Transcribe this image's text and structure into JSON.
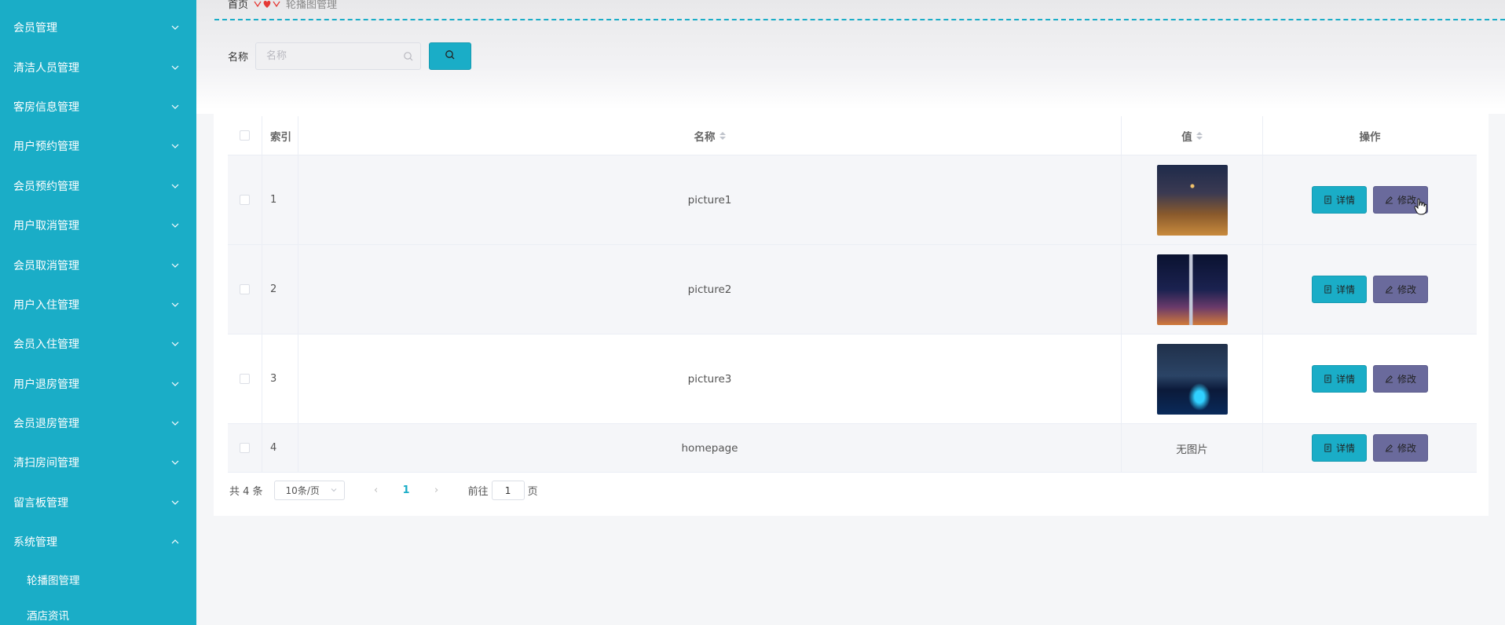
{
  "sidebar": {
    "items": [
      {
        "label": "会员管理"
      },
      {
        "label": "清洁人员管理"
      },
      {
        "label": "客房信息管理"
      },
      {
        "label": "用户预约管理"
      },
      {
        "label": "会员预约管理"
      },
      {
        "label": "用户取消管理"
      },
      {
        "label": "会员取消管理"
      },
      {
        "label": "用户入住管理"
      },
      {
        "label": "会员入住管理"
      },
      {
        "label": "用户退房管理"
      },
      {
        "label": "会员退房管理"
      },
      {
        "label": "清扫房间管理"
      },
      {
        "label": "留言板管理"
      },
      {
        "label": "系统管理",
        "expanded": true
      }
    ],
    "sub_items": [
      {
        "label": "轮播图管理"
      },
      {
        "label": "酒店资讯"
      }
    ],
    "bg_color": "#1aadc7"
  },
  "breadcrumb": {
    "home": "首页",
    "current": "轮播图管理"
  },
  "search": {
    "label": "名称",
    "placeholder": "名称",
    "value": ""
  },
  "table": {
    "headers": {
      "index": "索引",
      "name": "名称",
      "value": "值",
      "actions": "操作"
    },
    "rows": [
      {
        "index": "1",
        "name": "picture1",
        "value_type": "image",
        "image": "city-night-tower"
      },
      {
        "index": "2",
        "name": "picture2",
        "value_type": "image",
        "image": "city-night-skyscraper"
      },
      {
        "index": "3",
        "name": "picture3",
        "value_type": "image",
        "image": "bridge-night-lights"
      },
      {
        "index": "4",
        "name": "homepage",
        "value_type": "text",
        "value_text": "无图片"
      }
    ],
    "actions": {
      "detail": "详情",
      "edit": "修改"
    }
  },
  "pagination": {
    "total": "共 4 条",
    "page_size": "10条/页",
    "current_page": "1",
    "goto_label": "前往",
    "goto_value": "1",
    "page_suffix": "页"
  },
  "colors": {
    "accent": "#1aadc7",
    "edit_button": "#6a6a9c",
    "breadcrumb_separator": "#e53935"
  }
}
